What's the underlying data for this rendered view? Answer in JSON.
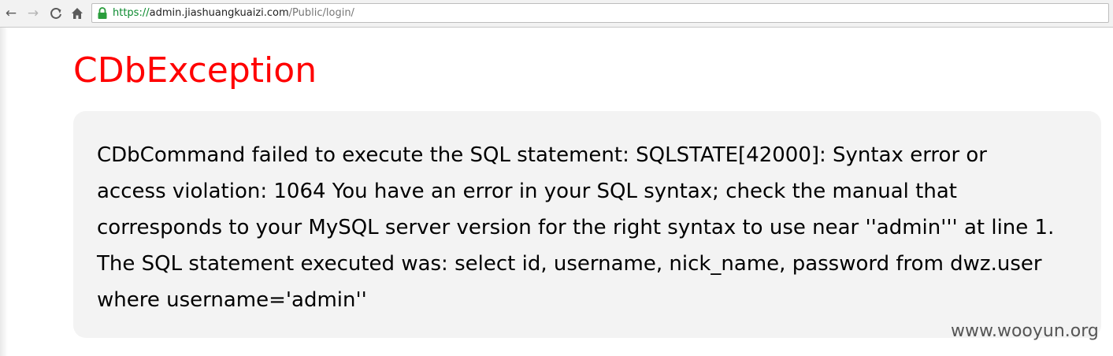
{
  "browser": {
    "url_scheme": "https://",
    "url_host": "admin.jiashuangkuaizi.com",
    "url_path": "/Public/login/",
    "icons": [
      "back-arrow-icon",
      "forward-arrow-icon",
      "reload-icon",
      "home-icon",
      "lock-icon"
    ]
  },
  "page": {
    "title": "CDbException",
    "message": "CDbCommand failed to execute the SQL statement: SQLSTATE[42000]: Syntax error or access violation: 1064 You have an error in your SQL syntax; check the manual that corresponds to your MySQL server version for the right syntax to use near ''admin''' at line 1. The SQL statement executed was: select id, username, nick_name, password from dwz.user where username='admin''"
  },
  "watermark": "www.wooyun.org",
  "colors": {
    "title": "#ff0000",
    "secure_scheme": "#0b8a2e",
    "message_background": "#f3f3f3"
  }
}
